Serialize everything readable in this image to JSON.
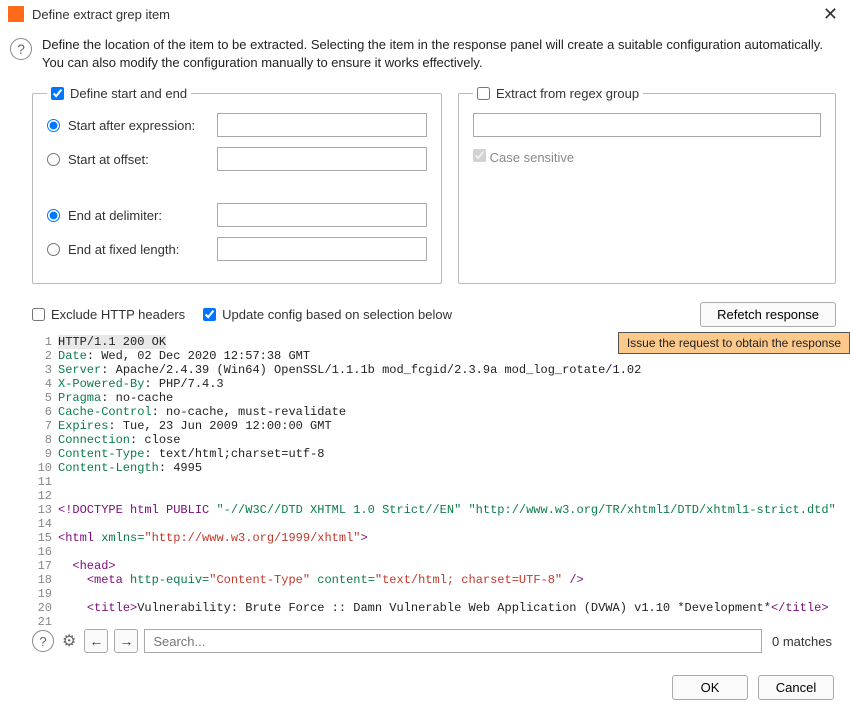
{
  "title": "Define extract grep item",
  "help_text": "Define the location of the item to be extracted. Selecting the item in the response panel will create a suitable configuration automatically. You can also modify the configuration manually to ensure it works effectively.",
  "groups": {
    "left": {
      "legend": "Define start and end",
      "legend_checked": true,
      "start_after_expr": {
        "label": "Start after expression:",
        "checked": true,
        "value": ""
      },
      "start_at_offset": {
        "label": "Start at offset:",
        "checked": false,
        "value": ""
      },
      "end_at_delimiter": {
        "label": "End at delimiter:",
        "checked": true,
        "value": ""
      },
      "end_at_fixed_len": {
        "label": "End at fixed length:",
        "checked": false,
        "value": ""
      }
    },
    "right": {
      "legend": "Extract from regex group",
      "legend_checked": false,
      "regex_value": "",
      "case_sensitive": {
        "label": "Case sensitive",
        "checked": true
      }
    }
  },
  "options": {
    "exclude_headers": {
      "label": "Exclude HTTP headers",
      "checked": false
    },
    "update_config": {
      "label": "Update config based on selection below",
      "checked": true
    },
    "refetch": "Refetch response"
  },
  "tooltip": "Issue the request to obtain the response",
  "response_lines": [
    {
      "n": 1,
      "segments": [
        {
          "t": "HTTP/1.1 200 OK",
          "c": "txt hl"
        }
      ]
    },
    {
      "n": 2,
      "segments": [
        {
          "t": "Date",
          "c": "hdr"
        },
        {
          "t": ": Wed, 02 Dec 2020 12:57:38 GMT",
          "c": "txt"
        }
      ]
    },
    {
      "n": 3,
      "segments": [
        {
          "t": "Server",
          "c": "hdr"
        },
        {
          "t": ": Apache/2.4.39 (Win64) OpenSSL/1.1.1b mod_fcgid/2.3.9a mod_log_rotate/1.02",
          "c": "txt"
        }
      ]
    },
    {
      "n": 4,
      "segments": [
        {
          "t": "X-Powered-By",
          "c": "hdr"
        },
        {
          "t": ": PHP/7.4.3",
          "c": "txt"
        }
      ]
    },
    {
      "n": 5,
      "segments": [
        {
          "t": "Pragma",
          "c": "hdr"
        },
        {
          "t": ": no-cache",
          "c": "txt"
        }
      ]
    },
    {
      "n": 6,
      "segments": [
        {
          "t": "Cache-Control",
          "c": "hdr"
        },
        {
          "t": ": no-cache, must-revalidate",
          "c": "txt"
        }
      ]
    },
    {
      "n": 7,
      "segments": [
        {
          "t": "Expires",
          "c": "hdr"
        },
        {
          "t": ": Tue, 23 Jun 2009 12:00:00 GMT",
          "c": "txt"
        }
      ]
    },
    {
      "n": 8,
      "segments": [
        {
          "t": "Connection",
          "c": "hdr"
        },
        {
          "t": ": close",
          "c": "txt"
        }
      ]
    },
    {
      "n": 9,
      "segments": [
        {
          "t": "Content-Type",
          "c": "hdr"
        },
        {
          "t": ": text/html;charset=utf-8",
          "c": "txt"
        }
      ]
    },
    {
      "n": 10,
      "segments": [
        {
          "t": "Content-Length",
          "c": "hdr"
        },
        {
          "t": ": 4995",
          "c": "txt"
        }
      ]
    },
    {
      "n": 11,
      "segments": [
        {
          "t": "",
          "c": "txt"
        }
      ]
    },
    {
      "n": 12,
      "segments": [
        {
          "t": "",
          "c": "txt"
        }
      ]
    },
    {
      "n": 13,
      "segments": [
        {
          "t": "<!DOCTYPE html PUBLIC ",
          "c": "tag"
        },
        {
          "t": "\"-//W3C//DTD XHTML 1.0 Strict//EN\"",
          "c": "attr"
        },
        {
          "t": " ",
          "c": "txt"
        },
        {
          "t": "\"http://www.w3.org/TR/xhtml1/DTD/xhtml1-strict.dtd\"",
          "c": "attr"
        },
        {
          "t": ">",
          "c": "tag"
        }
      ]
    },
    {
      "n": 14,
      "segments": [
        {
          "t": "",
          "c": "txt"
        }
      ]
    },
    {
      "n": 15,
      "segments": [
        {
          "t": "<html ",
          "c": "tag"
        },
        {
          "t": "xmlns=",
          "c": "attr"
        },
        {
          "t": "\"http://www.w3.org/1999/xhtml\"",
          "c": "str"
        },
        {
          "t": ">",
          "c": "tag"
        }
      ]
    },
    {
      "n": 16,
      "segments": [
        {
          "t": "",
          "c": "txt"
        }
      ]
    },
    {
      "n": 17,
      "segments": [
        {
          "t": "  ",
          "c": "txt"
        },
        {
          "t": "<head>",
          "c": "tag"
        }
      ]
    },
    {
      "n": 18,
      "segments": [
        {
          "t": "    ",
          "c": "txt"
        },
        {
          "t": "<meta ",
          "c": "tag"
        },
        {
          "t": "http-equiv=",
          "c": "attr"
        },
        {
          "t": "\"Content-Type\"",
          "c": "str"
        },
        {
          "t": " ",
          "c": "txt"
        },
        {
          "t": "content=",
          "c": "attr"
        },
        {
          "t": "\"text/html; charset=UTF-8\"",
          "c": "str"
        },
        {
          "t": " />",
          "c": "tag"
        }
      ]
    },
    {
      "n": 19,
      "segments": [
        {
          "t": "",
          "c": "txt"
        }
      ]
    },
    {
      "n": 20,
      "segments": [
        {
          "t": "    ",
          "c": "txt"
        },
        {
          "t": "<title>",
          "c": "tag"
        },
        {
          "t": "Vulnerability: Brute Force :: Damn Vulnerable Web Application (DVWA) v1.10 *Development*",
          "c": "txt"
        },
        {
          "t": "</title>",
          "c": "tag"
        }
      ]
    },
    {
      "n": 21,
      "segments": [
        {
          "t": "",
          "c": "txt"
        }
      ]
    }
  ],
  "search": {
    "placeholder": "Search...",
    "matches": "0 matches"
  },
  "footer": {
    "ok": "OK",
    "cancel": "Cancel"
  }
}
